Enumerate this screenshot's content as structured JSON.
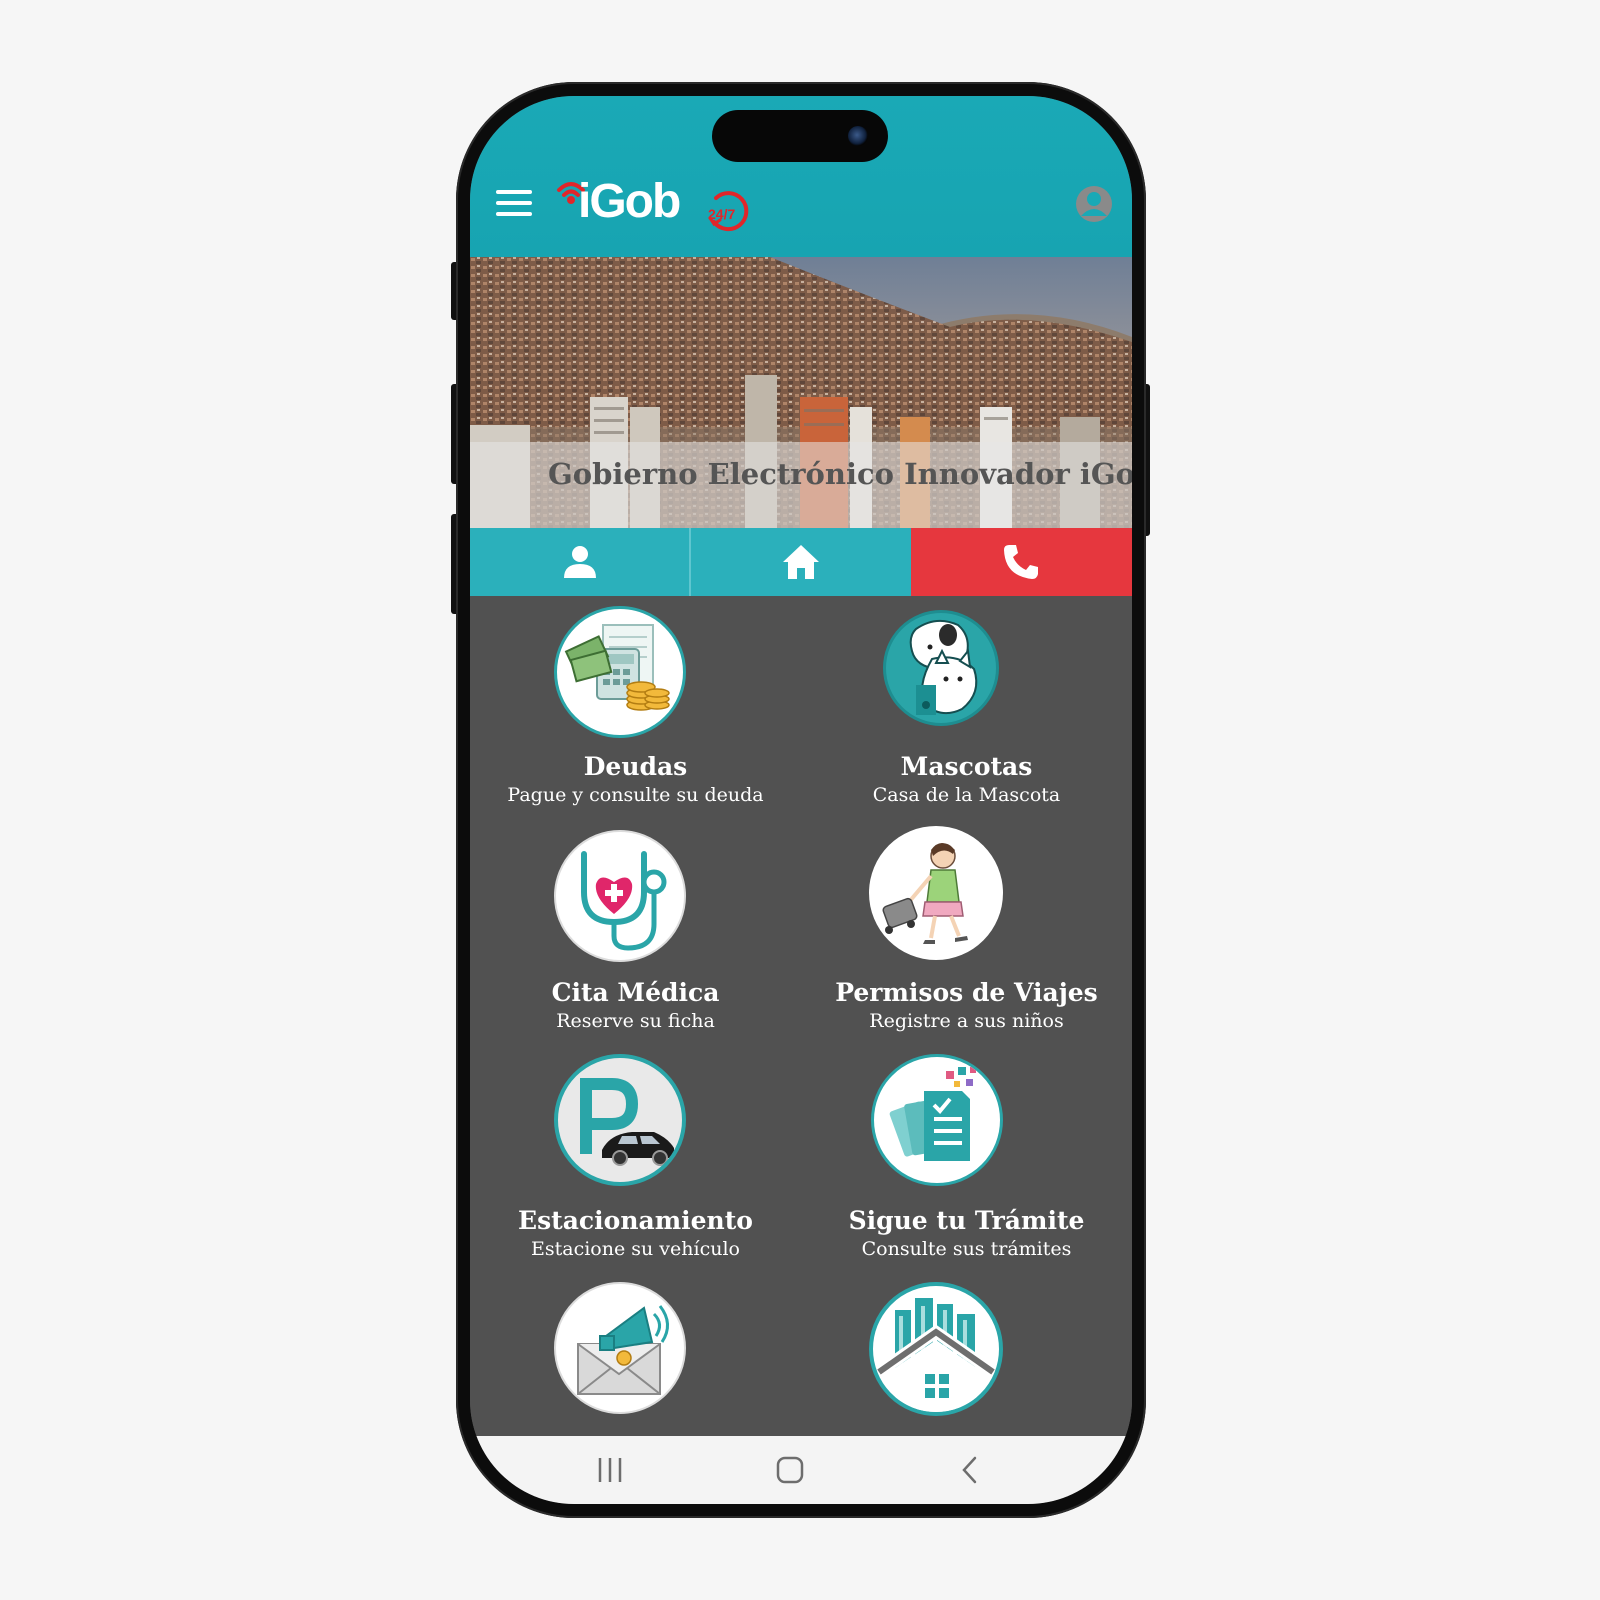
{
  "header": {
    "logo_text": "iGob",
    "logo_badge": "24/7",
    "menu_icon": "hamburger-menu-icon",
    "account_icon": "account-circle-icon"
  },
  "banner": {
    "caption": "Gobierno Electrónico Innovador iGob"
  },
  "tabs": [
    {
      "icon": "person-icon"
    },
    {
      "icon": "home-icon"
    },
    {
      "icon": "phone-icon"
    }
  ],
  "services": [
    {
      "title": "Deudas",
      "subtitle": "Pague y consulte su deuda",
      "icon": "money-calculator-icon"
    },
    {
      "title": "Mascotas",
      "subtitle": "Casa de la Mascota",
      "icon": "pets-icon"
    },
    {
      "title": "Cita Médica",
      "subtitle": "Reserve su ficha",
      "icon": "stethoscope-heart-icon"
    },
    {
      "title": "Permisos de Viajes",
      "subtitle": "Registre a sus niños",
      "icon": "child-traveler-icon"
    },
    {
      "title": "Estacionamiento",
      "subtitle": "Estacione su vehículo",
      "icon": "parking-car-icon"
    },
    {
      "title": "Sigue tu Trámite",
      "subtitle": "Consulte sus trámites",
      "icon": "documents-checklist-icon"
    },
    {
      "title": "",
      "subtitle": "",
      "icon": "megaphone-envelope-icon"
    },
    {
      "title": "",
      "subtitle": "",
      "icon": "city-house-icon"
    }
  ],
  "navbar": {
    "recents_icon": "recent-apps-icon",
    "home_icon": "home-button-icon",
    "back_icon": "back-chevron-icon"
  },
  "colors": {
    "header_teal": "#1aa9b6",
    "tab_teal": "#2bb0bb",
    "call_red": "#e6373e",
    "grid_background": "#515151",
    "logo_red": "#e1262a",
    "icon_teal": "#2aa5a8"
  }
}
